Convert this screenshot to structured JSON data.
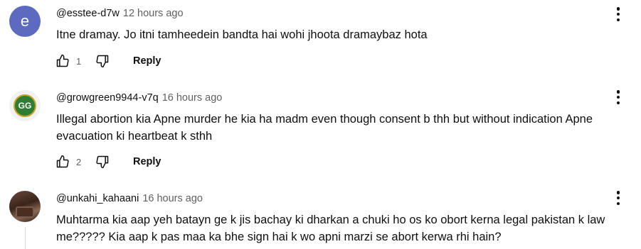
{
  "comments": [
    {
      "avatar_letter": "e",
      "avatar_color": "#5c6bc0",
      "handle": "@esstee-d7w",
      "time": "12 hours ago",
      "text": "Itne dramay. Jo itni tamheedein bandta hai wohi jhoota dramaybaz hota",
      "likes": "1",
      "reply_label": "Reply"
    },
    {
      "avatar_badge": "GG",
      "handle": "@growgreen9944-v7q",
      "time": "16 hours ago",
      "text": "Illegal abortion kia Apne murder he kia ha madm even though consent b thh but without indication Apne evacuation ki heartbeat k sthh",
      "likes": "2",
      "reply_label": "Reply"
    },
    {
      "handle": "@unkahi_kahaani",
      "time": "16 hours ago",
      "text": "Muhtarma kia aap yeh batayn ge k jis bachay ki dharkan a chuki ho os ko obort kerna legal pakistan k law me????? Kia aap k pas maa ka bhe sign hai k wo apni marzi se abort kerwa rhi hain?"
    }
  ],
  "icons": {
    "like": "thumbs-up-icon",
    "dislike": "thumbs-down-icon",
    "menu": "more-vert-icon"
  }
}
